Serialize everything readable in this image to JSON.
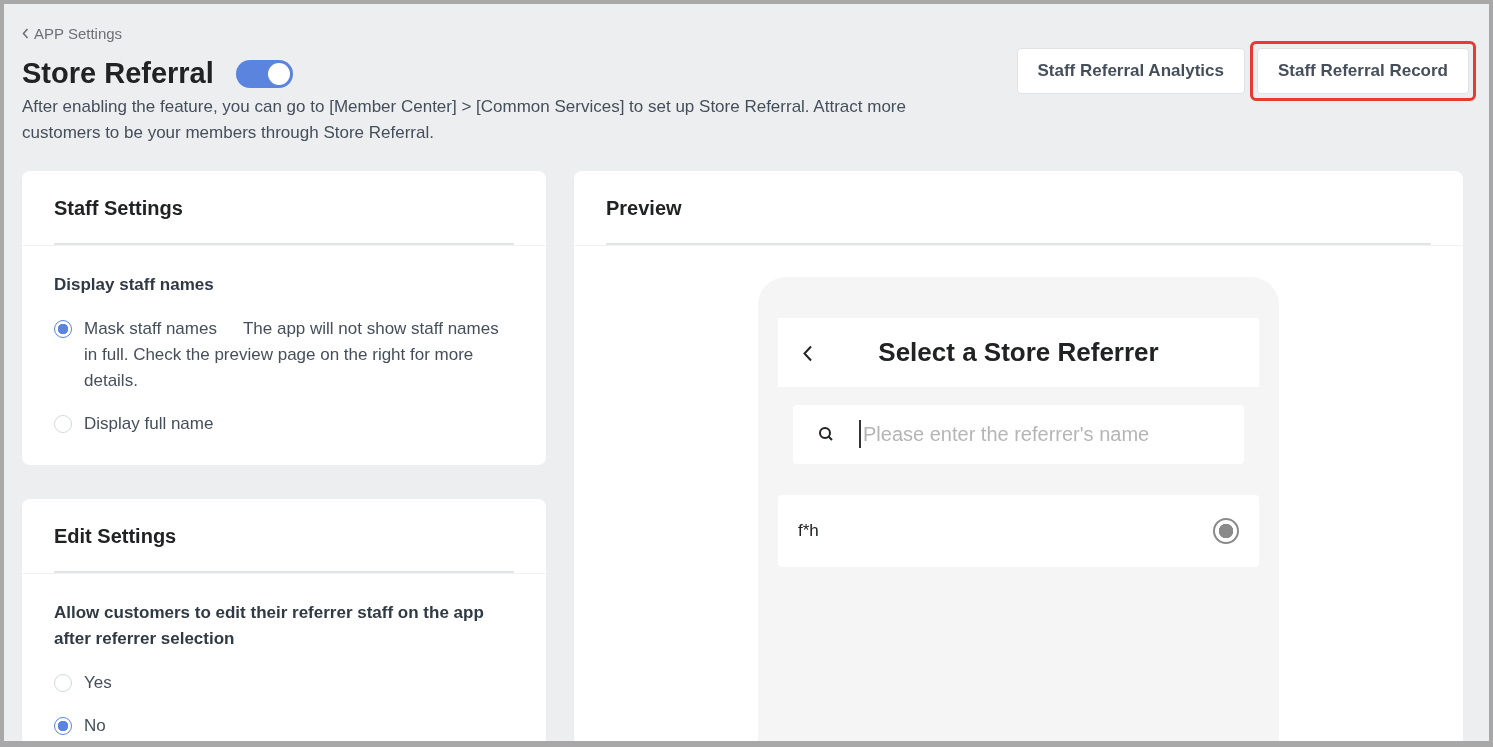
{
  "breadcrumb": {
    "label": "APP Settings"
  },
  "header": {
    "title": "Store Referral",
    "enabled": true,
    "description": "After enabling the feature, you can go to [Member Center] > [Common Services] to set up Store Referral. Attract more customers to be your members through Store Referral."
  },
  "actions": [
    {
      "label": "Staff Referral Analytics",
      "highlighted": false
    },
    {
      "label": "Staff Referral Record",
      "highlighted": true
    }
  ],
  "settings_cards": [
    {
      "title": "Staff Settings",
      "groups": [
        {
          "label": "Display staff names",
          "options": [
            {
              "label": "Mask staff names",
              "note": "The app will not show staff names in full. Check the preview page on the right for more details.",
              "selected": true
            },
            {
              "label": "Display full name",
              "selected": false
            }
          ]
        }
      ]
    },
    {
      "title": "Edit Settings",
      "groups": [
        {
          "label": "Allow customers to edit their referrer staff on the app after referrer selection",
          "options": [
            {
              "label": "Yes",
              "selected": false
            },
            {
              "label": "No",
              "selected": true
            }
          ]
        }
      ]
    }
  ],
  "preview": {
    "title": "Preview",
    "phone": {
      "title": "Select a Store Referrer",
      "search": {
        "placeholder": "Please enter the referrer's name"
      },
      "referrers": [
        {
          "name": "f*h",
          "selected": true
        }
      ]
    }
  }
}
